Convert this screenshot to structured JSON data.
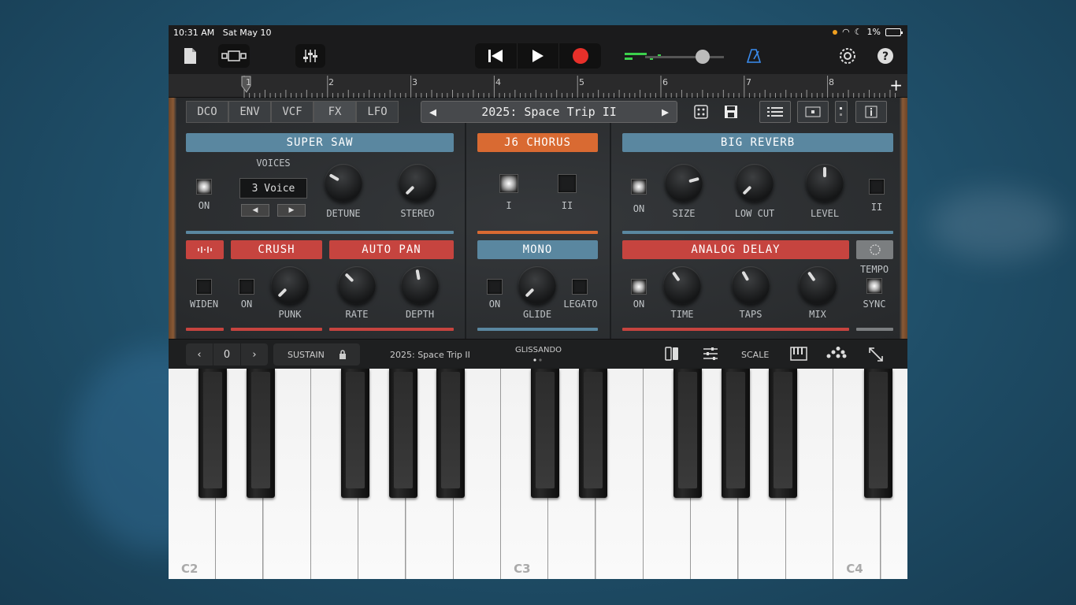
{
  "status": {
    "time": "10:31 AM",
    "date": "Sat May 10",
    "battery": "1%"
  },
  "ruler": {
    "bars": [
      "1",
      "2",
      "3",
      "4",
      "5",
      "6",
      "7",
      "8"
    ]
  },
  "tabs": [
    "DCO",
    "ENV",
    "VCF",
    "FX",
    "LFO"
  ],
  "preset": {
    "name": "2025: Space Trip II"
  },
  "super_saw": {
    "title": "SUPER SAW",
    "on": "ON",
    "voices_label": "VOICES",
    "voices_value": "3 Voice",
    "detune": "DETUNE",
    "stereo": "STEREO"
  },
  "chorus": {
    "title": "J6 CHORUS",
    "i": "I",
    "ii": "II"
  },
  "reverb": {
    "title": "BIG REVERB",
    "on": "ON",
    "size": "SIZE",
    "low_cut": "LOW CUT",
    "level": "LEVEL",
    "ii": "II"
  },
  "row2": {
    "crush": "CRUSH",
    "auto_pan": "AUTO PAN",
    "widen": "WIDEN",
    "on": "ON",
    "punk": "PUNK",
    "rate": "RATE",
    "depth": "DEPTH"
  },
  "mono": {
    "title": "MONO",
    "on": "ON",
    "glide": "GLIDE",
    "legato": "LEGATO"
  },
  "delay": {
    "title": "ANALOG DELAY",
    "on": "ON",
    "time": "TIME",
    "taps": "TAPS",
    "mix": "MIX",
    "tempo": "TEMPO",
    "sync": "SYNC"
  },
  "kbbar": {
    "octave": "0",
    "sustain": "SUSTAIN",
    "preset": "2025: Space Trip II",
    "glissando": "GLISSANDO",
    "scale": "SCALE"
  },
  "keys": {
    "c2": "C2",
    "c3": "C3",
    "c4": "C4"
  },
  "colors": {
    "blue": "#5a87a0",
    "orange": "#d96a32",
    "red": "#c6443f",
    "record": "#e8302a",
    "metronome": "#3a8df0"
  }
}
